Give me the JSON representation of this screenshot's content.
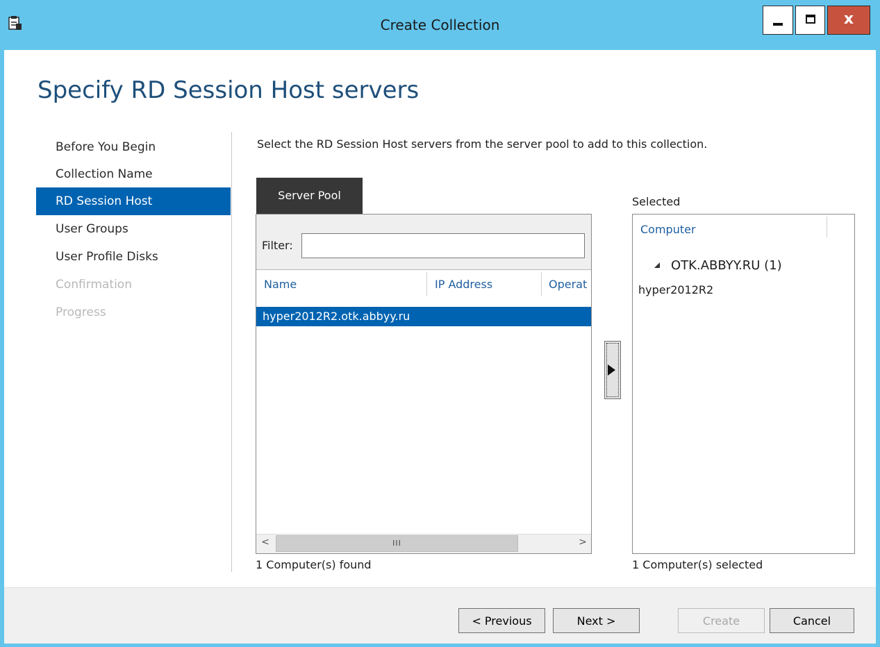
{
  "window": {
    "title": "Create Collection",
    "close_glyph": "x",
    "accent_color": "#63c5ec",
    "icon": "wizard-app-icon"
  },
  "page": {
    "heading": "Specify RD Session Host servers",
    "instructions": "Select the RD Session Host servers from the server pool to add to this collection."
  },
  "nav": {
    "items": [
      {
        "label": "Before You Begin",
        "state": "normal"
      },
      {
        "label": "Collection Name",
        "state": "normal"
      },
      {
        "label": "RD Session Host",
        "state": "selected"
      },
      {
        "label": "User Groups",
        "state": "normal"
      },
      {
        "label": "User Profile Disks",
        "state": "normal"
      },
      {
        "label": "Confirmation",
        "state": "disabled"
      },
      {
        "label": "Progress",
        "state": "disabled"
      }
    ],
    "selected_color": "#0063b1"
  },
  "server_pool": {
    "tab_label": "Server Pool",
    "filter_label": "Filter:",
    "filter_value": "",
    "columns": [
      "Name",
      "IP Address",
      "Operat"
    ],
    "rows": [
      {
        "name": "hyper2012R2.otk.abbyy.ru",
        "ip": "",
        "os": "",
        "selected": true
      }
    ],
    "scroll_left": "<",
    "scroll_thumb": "III",
    "scroll_right": ">",
    "status": "1 Computer(s) found"
  },
  "selected": {
    "label": "Selected",
    "column": "Computer",
    "group_label": "OTK.ABBYY.RU (1)",
    "items": [
      "hyper2012R2"
    ],
    "status": "1 Computer(s) selected"
  },
  "footer": {
    "previous": "< Previous",
    "next": "Next >",
    "create": "Create",
    "cancel": "Cancel"
  }
}
